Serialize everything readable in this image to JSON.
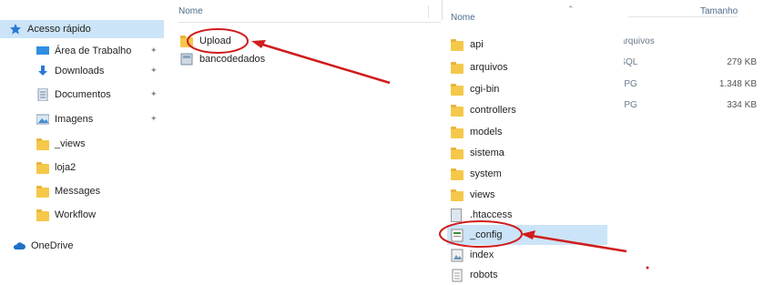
{
  "nav": {
    "items": [
      {
        "label": "Acesso rápido",
        "icon": "star-icon",
        "pinned": false
      },
      {
        "label": "Área de Trabalho",
        "icon": "desktop-icon",
        "pinned": true
      },
      {
        "label": "Downloads",
        "icon": "download-icon",
        "pinned": true
      },
      {
        "label": "Documentos",
        "icon": "documents-icon",
        "pinned": true
      },
      {
        "label": "Imagens",
        "icon": "images-icon",
        "pinned": true
      },
      {
        "label": "_views",
        "icon": "folder-icon",
        "pinned": false
      },
      {
        "label": "loja2",
        "icon": "folder-icon",
        "pinned": false
      },
      {
        "label": "Messages",
        "icon": "folder-icon",
        "pinned": false
      },
      {
        "label": "Workflow",
        "icon": "folder-icon",
        "pinned": false
      },
      {
        "label": "OneDrive",
        "icon": "cloud-icon",
        "pinned": false
      }
    ]
  },
  "list1": {
    "header": "Nome",
    "items": [
      {
        "label": "Upload",
        "icon": "folder-icon"
      },
      {
        "label": "bancodedados",
        "icon": "database-icon"
      }
    ]
  },
  "overlay": {
    "header": "Nome",
    "items": [
      {
        "label": "api",
        "icon": "folder-icon"
      },
      {
        "label": "arquivos",
        "icon": "folder-icon"
      },
      {
        "label": "cgi-bin",
        "icon": "folder-icon"
      },
      {
        "label": "controllers",
        "icon": "folder-icon"
      },
      {
        "label": "models",
        "icon": "folder-icon"
      },
      {
        "label": "sistema",
        "icon": "folder-icon"
      },
      {
        "label": "system",
        "icon": "folder-icon"
      },
      {
        "label": "views",
        "icon": "folder-icon"
      },
      {
        "label": ".htaccess",
        "icon": "file-icon"
      },
      {
        "label": "_config",
        "icon": "config-file-icon"
      },
      {
        "label": "index",
        "icon": "image-file-icon"
      },
      {
        "label": "robots",
        "icon": "text-file-icon"
      }
    ]
  },
  "right": {
    "size_header": "Tamanho",
    "type_header": "de arquivos",
    "rows": [
      {
        "type": "vo SQL",
        "size": "279 KB"
      },
      {
        "type": "vo JPG",
        "size": "1.348 KB"
      },
      {
        "type": "vo JPG",
        "size": "334 KB"
      }
    ]
  },
  "colors": {
    "selection": "#cce4f7",
    "annotation": "#d01c1c",
    "folder": "#f5c84a"
  }
}
